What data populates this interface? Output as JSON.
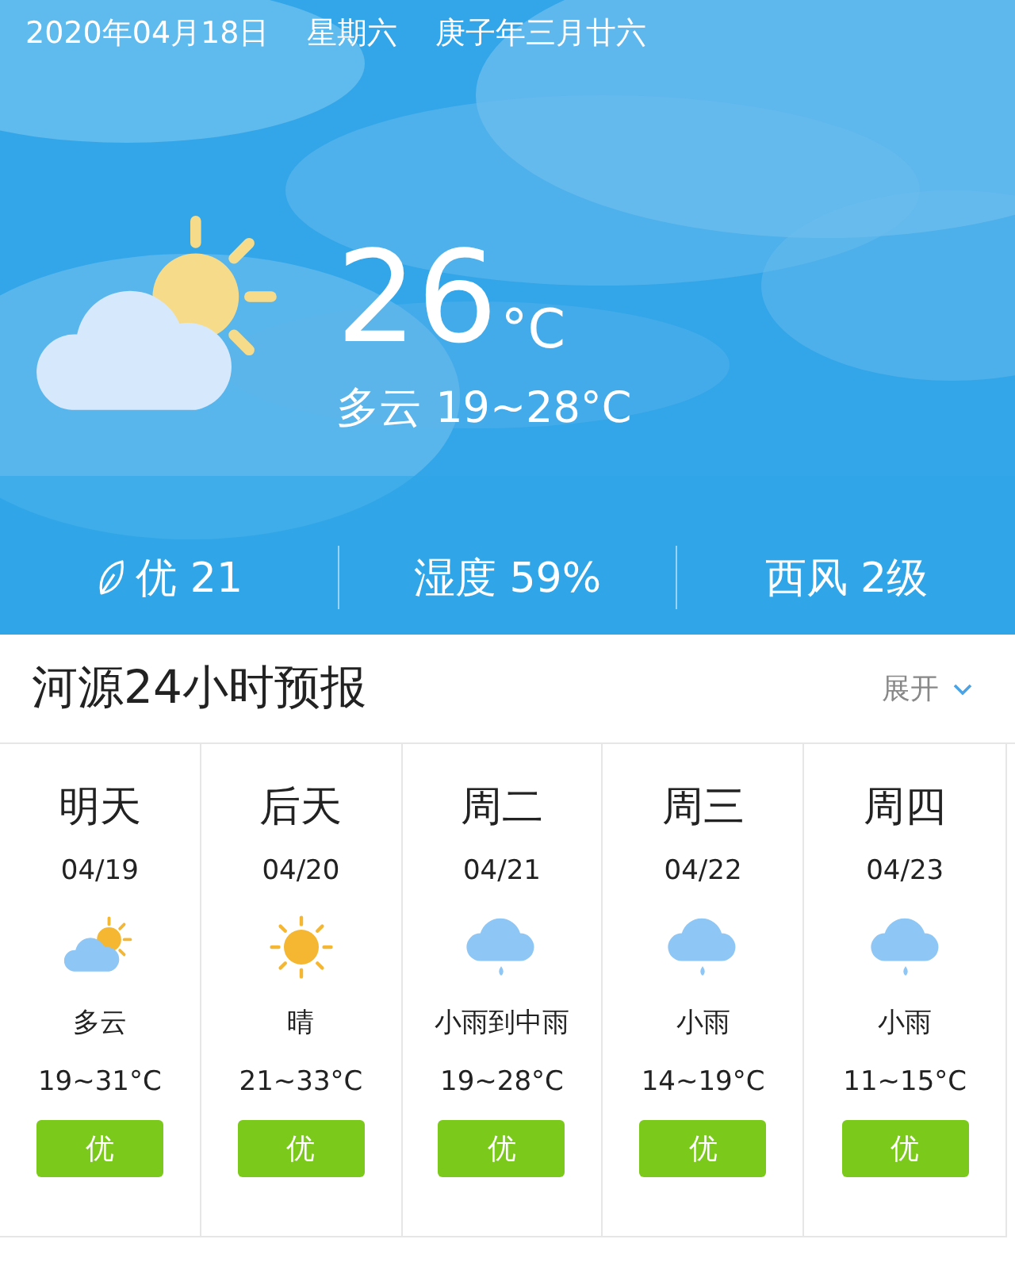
{
  "date_bar": {
    "date": "2020年04月18日",
    "weekday": "星期六",
    "lunar_date": "庚子年三月廿六"
  },
  "current": {
    "kind": "partly_cloudy",
    "temperature": "26",
    "unit": "°C",
    "summary": "多云 19~28°C"
  },
  "stats": [
    {
      "kind": "air",
      "text": "优 21"
    },
    {
      "kind": "plain",
      "text": "湿度 59%"
    },
    {
      "kind": "plain",
      "text": "西风 2级"
    }
  ],
  "forecast_header": {
    "title": "河源24小时预报",
    "expand_label": "展开",
    "expanded": false
  },
  "days": [
    {
      "day": "明天",
      "date": "04/19",
      "kind": "partly_cloudy",
      "condition": "多云",
      "range": "19~31°C",
      "aqi": "优"
    },
    {
      "day": "后天",
      "date": "04/20",
      "kind": "sunny",
      "condition": "晴",
      "range": "21~33°C",
      "aqi": "优"
    },
    {
      "day": "周二",
      "date": "04/21",
      "kind": "rain",
      "condition": "小雨到中雨",
      "range": "19~28°C",
      "aqi": "优"
    },
    {
      "day": "周三",
      "date": "04/22",
      "kind": "rain",
      "condition": "小雨",
      "range": "14~19°C",
      "aqi": "优"
    },
    {
      "day": "周四",
      "date": "04/23",
      "kind": "rain",
      "condition": "小雨",
      "range": "11~15°C",
      "aqi": "优"
    }
  ]
}
